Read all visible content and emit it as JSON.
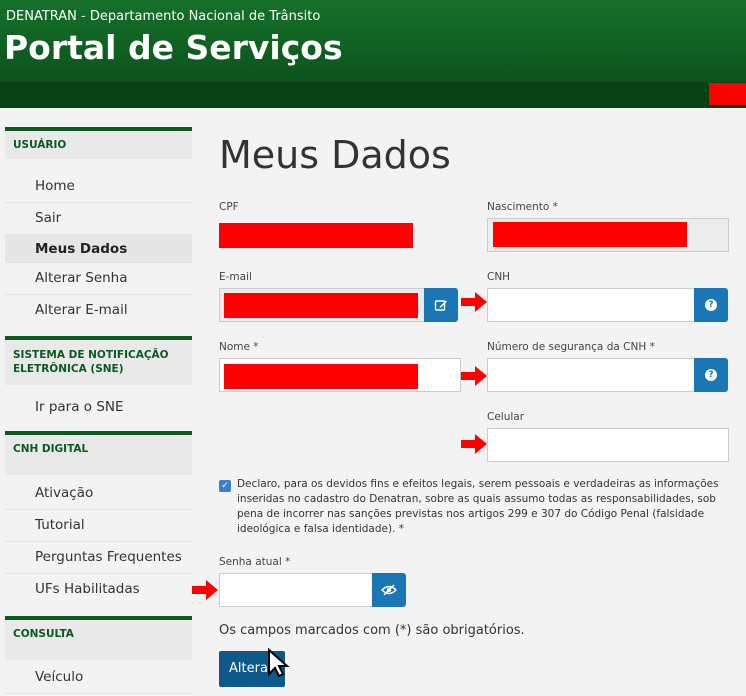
{
  "header": {
    "org": "DENATRAN - Departamento Nacional de Trânsito",
    "title": "Portal de Serviços"
  },
  "sidebar": {
    "sections": [
      {
        "title": "USUÁRIO",
        "items": [
          "Home",
          "Sair",
          "Meus Dados",
          "Alterar Senha",
          "Alterar E-mail"
        ]
      },
      {
        "title": "SISTEMA DE NOTIFICAÇÃO ELETRÔNICA (SNE)",
        "items": [
          "Ir para o SNE"
        ]
      },
      {
        "title": "CNH DIGITAL",
        "items": [
          "Ativação",
          "Tutorial",
          "Perguntas Frequentes",
          "UFs Habilitadas"
        ]
      },
      {
        "title": "CONSULTA",
        "items": [
          "Veículo"
        ]
      }
    ],
    "active_item": "Meus Dados"
  },
  "main": {
    "title": "Meus Dados",
    "fields": {
      "cpf_label": "CPF",
      "nascimento_label": "Nascimento *",
      "email_label": "E-mail",
      "cnh_label": "CNH",
      "nome_label": "Nome *",
      "cnh_seguranca_label": "Número de segurança da CNH *",
      "celular_label": "Celular",
      "senha_label": "Senha atual *"
    },
    "declaration": "Declaro, para os devidos fins e efeitos legais, serem pessoais e verdadeiras as informações inseridas no cadastro do Denatran, sobre as quais assumo todas as responsabilidades, sob pena de incorrer nas sanções previstas nos artigos 299 e 307 do Código Penal (falsidade ideológica e falsa identidade). *",
    "declaration_checked": true,
    "required_note": "Os campos marcados com (*) são obrigatórios.",
    "submit_label": "Alterar"
  },
  "colors": {
    "header_green": "#0d5a1f",
    "accent_blue": "#1a76b5",
    "redaction_red": "#ff0000"
  }
}
